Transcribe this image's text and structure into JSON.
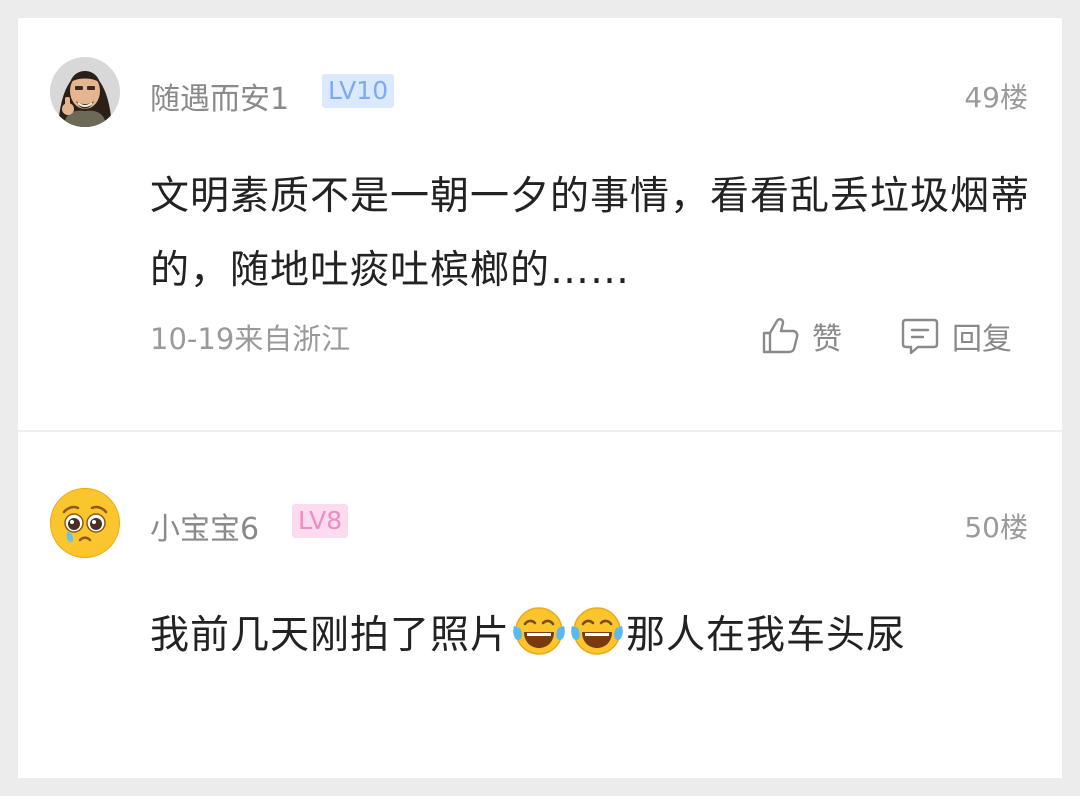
{
  "comments": [
    {
      "username": "随遇而安1",
      "level": "LV10",
      "floor": "49楼",
      "text": "文明素质不是一朝一夕的事情，看看乱丢垃圾烟蒂的，随地吐痰吐槟榔的……",
      "time_location": "10-19来自浙江",
      "like_label": "赞",
      "reply_label": "回复"
    },
    {
      "username": "小宝宝6",
      "level": "LV8",
      "floor": "50楼",
      "text_before_emoji": "我前几天刚拍了照片",
      "emojis": [
        "tears-of-joy-emoji",
        "tears-of-joy-emoji"
      ],
      "text_after_emoji": "那人在我车头尿"
    }
  ],
  "colors": {
    "level_blue_bg": "#dbe9ff",
    "level_blue_text": "#7eaaf0",
    "level_pink_bg": "#fbdcef",
    "level_pink_text": "#ef8ec4"
  }
}
